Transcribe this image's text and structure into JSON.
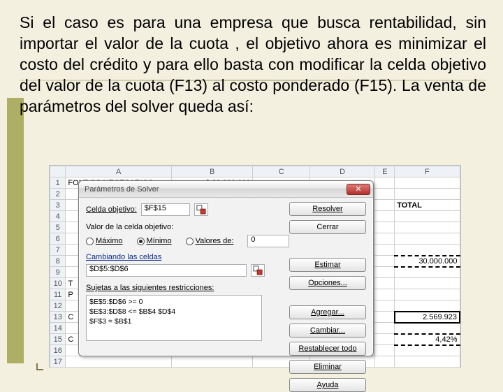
{
  "intro": "Si el caso es para una empresa que busca rentabilidad, sin importar el valor de la cuota , el objetivo ahora es minimizar el costo del crédito y para ello basta con modificar la celda objetivo del valor de la cuota (F13) al costo ponderado (F15). La venta de parámetros del solver queda así:",
  "sheet": {
    "cols": [
      "",
      "A",
      "B",
      "C",
      "D",
      "E",
      "F"
    ],
    "rows": {
      "1": {
        "A": "FONDOS NECESARIOS",
        "B": "$ 30.000.000"
      },
      "7": {
        "F_label": "TOTAL"
      },
      "8": {
        "F": "30.000.000"
      },
      "13": {
        "A": "C",
        "F": "2.569.923"
      },
      "15": {
        "A": "C",
        "F": "4,42%"
      },
      "partial10": "T",
      "partial11": "P"
    }
  },
  "dialog": {
    "title": "Parámetros de Solver",
    "celda_objetivo_label": "Celda objetivo:",
    "celda_objetivo": " $F$15",
    "valor_celda_label": "Valor de la celda objetivo:",
    "opt_max": "Máximo",
    "opt_min": "Mínimo",
    "opt_val": "Valores de:",
    "valde": "0",
    "cambiando_label": "Cambiando las celdas",
    "cambiando": " $D$5:$D$6",
    "restr_label": "Sujetas a las siguientes restricciones:",
    "restricciones": "$E$5:$D$6 >= 0\n$E$3:$D$8 <= $B$4 $D$4\n$F$3 = $B$1",
    "btn_resolver": "Resolver",
    "btn_cerrar": "Cerrar",
    "btn_estimar": "Estimar",
    "btn_opciones": "Opciones...",
    "btn_agregar": "Agregar...",
    "btn_cambiar": "Cambiar...",
    "btn_restablecer": "Restablecer todo",
    "btn_eliminar": "Eliminar",
    "btn_ayuda": "Ayuda"
  }
}
